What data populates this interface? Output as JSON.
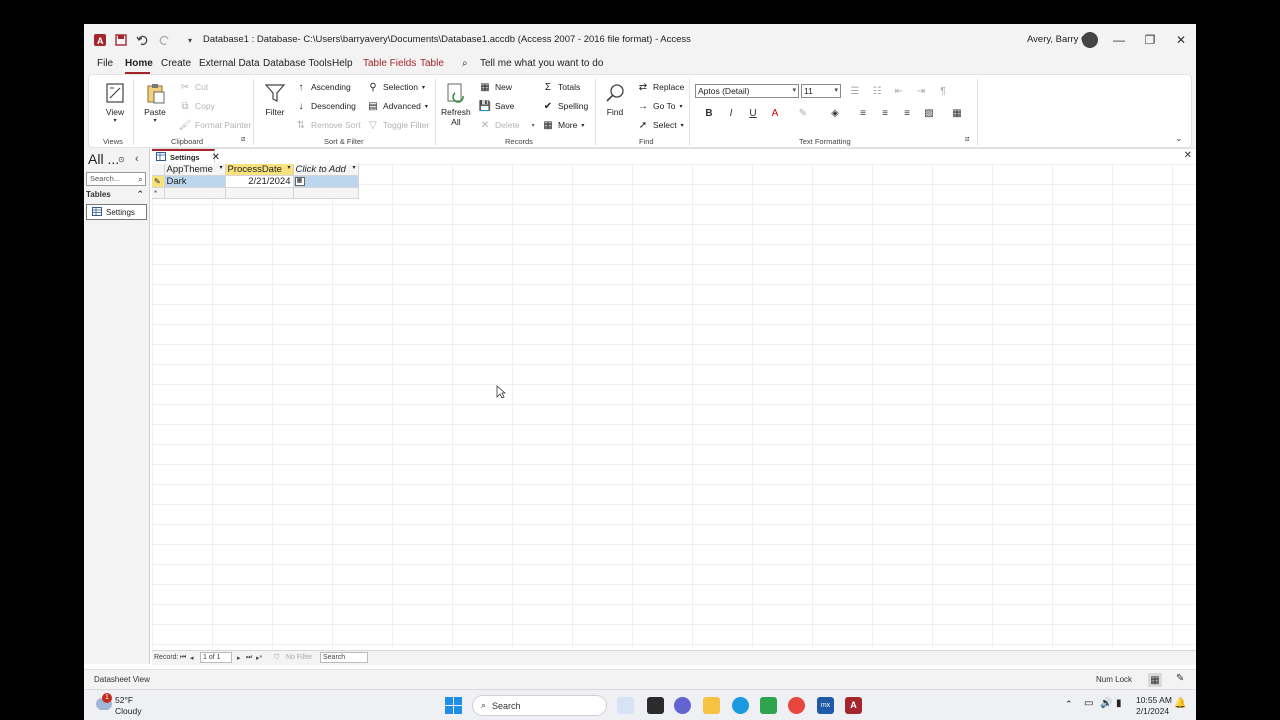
{
  "titlebar": {
    "title": "Database1 : Database- C:\\Users\\barryavery\\Documents\\Database1.accdb (Access 2007 - 2016 file format)  -  Access",
    "user": "Avery, Barry C"
  },
  "menu": {
    "tabs": [
      "File",
      "Home",
      "Create",
      "External Data",
      "Database Tools",
      "Help",
      "Table Fields",
      "Table"
    ],
    "tell_me": "Tell me what you want to do"
  },
  "ribbon": {
    "views": {
      "view": "View",
      "group": "Views"
    },
    "clipboard": {
      "paste": "Paste",
      "cut": "Cut",
      "copy": "Copy",
      "format_painter": "Format Painter",
      "group": "Clipboard"
    },
    "sort_filter": {
      "filter": "Filter",
      "ascending": "Ascending",
      "descending": "Descending",
      "remove_sort": "Remove Sort",
      "selection": "Selection",
      "advanced": "Advanced",
      "toggle_filter": "Toggle Filter",
      "group": "Sort & Filter"
    },
    "records": {
      "refresh": "Refresh",
      "refresh_all": "All",
      "new": "New",
      "save": "Save",
      "delete": "Delete",
      "totals": "Totals",
      "spelling": "Spelling",
      "more": "More",
      "group": "Records"
    },
    "find": {
      "find": "Find",
      "replace": "Replace",
      "goto": "Go To",
      "select": "Select",
      "group": "Find"
    },
    "text_formatting": {
      "font": "Aptos (Detail)",
      "size": "11",
      "group": "Text Formatting"
    }
  },
  "nav": {
    "title": "All ...",
    "search_placeholder": "Search...",
    "section": "Tables",
    "item": "Settings"
  },
  "doc": {
    "tab": "Settings",
    "columns": [
      "AppTheme",
      "ProcessDate",
      "Click to Add"
    ],
    "rows": [
      [
        "Dark",
        "2/21/2024"
      ]
    ]
  },
  "record_bar": {
    "label": "Record:",
    "position": "1 of 1",
    "filter": "No Filter",
    "search": "Search"
  },
  "status": {
    "view": "Datasheet View",
    "numlock": "Num Lock"
  },
  "taskbar": {
    "weather_temp": "52°F",
    "weather_desc": "Cloudy",
    "weather_badge": "1",
    "search": "Search",
    "time": "10:55 AM",
    "date": "2/1/2024"
  },
  "colors": {
    "accent": "#a4262c",
    "selection": "#bcd6ee",
    "active_header": "#f7e27e"
  }
}
